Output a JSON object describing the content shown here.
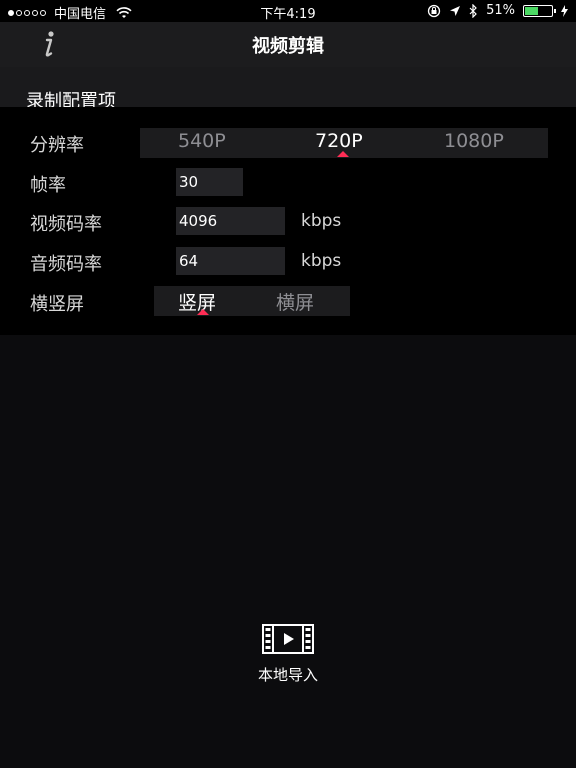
{
  "status_bar": {
    "carrier": "中国电信",
    "time": "下午4:19",
    "battery": "51%",
    "battery_level": 0.51
  },
  "nav": {
    "title": "视频剪辑",
    "info_icon": "info-icon"
  },
  "config": {
    "title": "录制配置项",
    "resolution": {
      "label": "分辨率",
      "options": [
        "540P",
        "720P",
        "1080P"
      ],
      "selected": "720P"
    },
    "frame_rate": {
      "label": "帧率",
      "value": "30"
    },
    "video_bitrate": {
      "label": "视频码率",
      "value": "4096",
      "unit": "kbps"
    },
    "audio_bitrate": {
      "label": "音频码率",
      "value": "64",
      "unit": "kbps"
    },
    "orientation": {
      "label": "横竖屏",
      "options": [
        "竖屏",
        "横屏"
      ],
      "selected": "竖屏"
    }
  },
  "import": {
    "label": "本地导入",
    "icon": "film-play-icon"
  },
  "colors": {
    "accent": "#ff2d55",
    "background": "#0c0c0e",
    "nav_background": "#1c1c1e"
  }
}
